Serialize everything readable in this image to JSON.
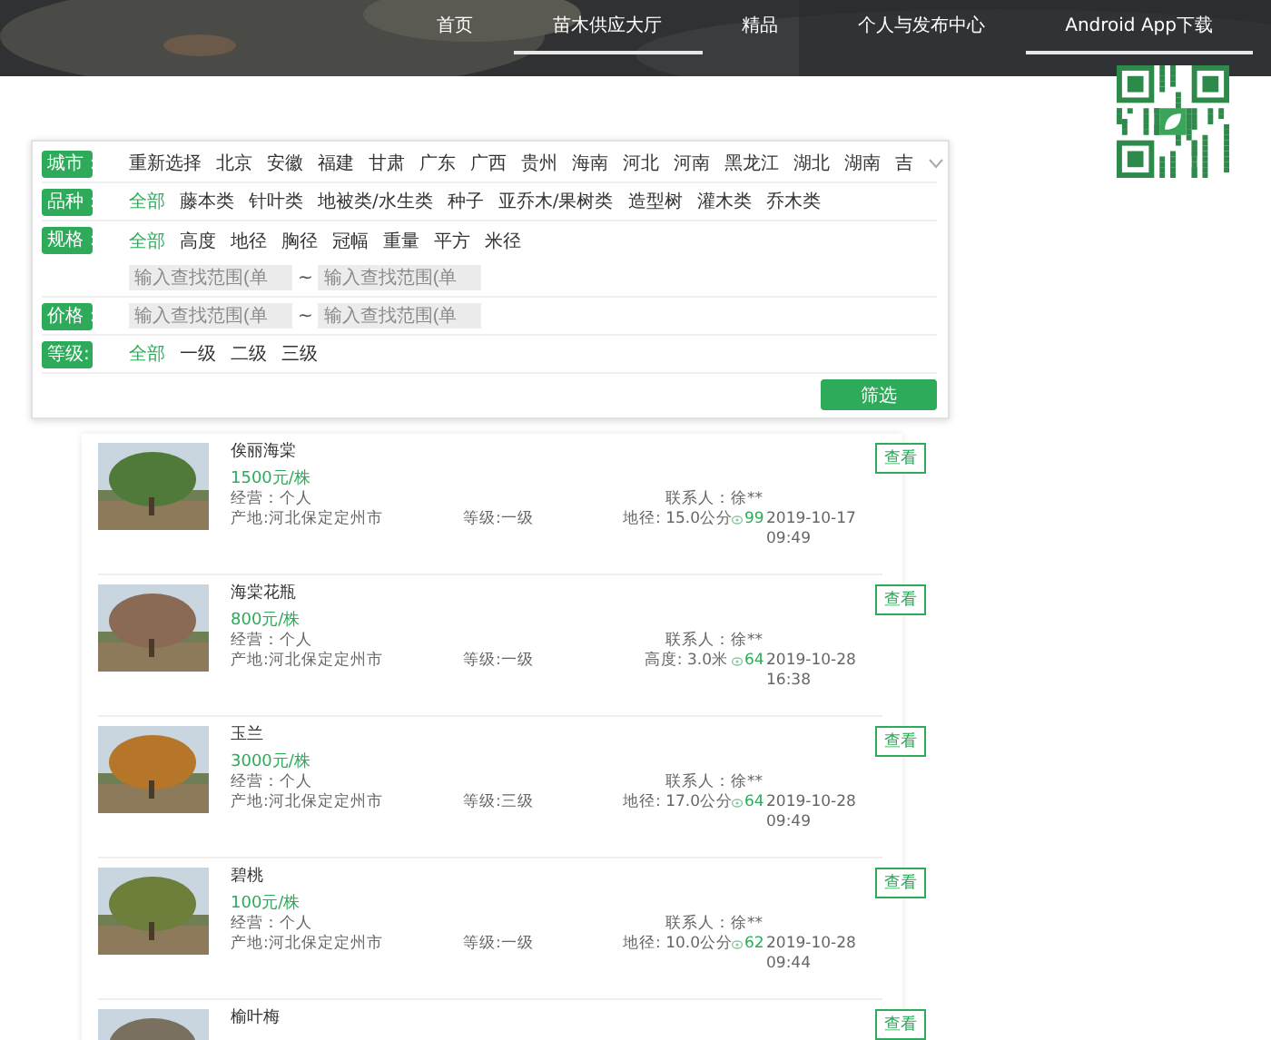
{
  "nav": [
    {
      "label": "首页",
      "selected": false
    },
    {
      "label": "苗木供应大厅",
      "selected": true
    },
    {
      "label": "精品",
      "selected": false
    },
    {
      "label": "个人与发布中心",
      "selected": false
    },
    {
      "label": "Android App下载",
      "selected": true
    }
  ],
  "filters": [
    {
      "label": "城市：",
      "expandable": true,
      "options": [
        {
          "label": "重新选择",
          "selected": false
        },
        {
          "label": "北京",
          "selected": false
        },
        {
          "label": "安徽",
          "selected": false
        },
        {
          "label": "福建",
          "selected": false
        },
        {
          "label": "甘肃",
          "selected": false
        },
        {
          "label": "广东",
          "selected": false
        },
        {
          "label": "广西",
          "selected": false
        },
        {
          "label": "贵州",
          "selected": false
        },
        {
          "label": "海南",
          "selected": false
        },
        {
          "label": "河北",
          "selected": false
        },
        {
          "label": "河南",
          "selected": false
        },
        {
          "label": "黑龙江",
          "selected": false
        },
        {
          "label": "湖北",
          "selected": false
        },
        {
          "label": "湖南",
          "selected": false
        },
        {
          "label": "吉",
          "selected": false
        }
      ]
    },
    {
      "label": "品种：",
      "options": [
        {
          "label": "全部",
          "selected": true
        },
        {
          "label": "藤本类",
          "selected": false
        },
        {
          "label": "针叶类",
          "selected": false
        },
        {
          "label": "地被类/水生类",
          "selected": false
        },
        {
          "label": "种子",
          "selected": false
        },
        {
          "label": "亚乔木/果树类",
          "selected": false
        },
        {
          "label": "造型树",
          "selected": false
        },
        {
          "label": "灌木类",
          "selected": false
        },
        {
          "label": "乔木类",
          "selected": false
        }
      ]
    },
    {
      "label": "规格：",
      "options": [
        {
          "label": "全部",
          "selected": true
        },
        {
          "label": "高度",
          "selected": false
        },
        {
          "label": "地径",
          "selected": false
        },
        {
          "label": "胸径",
          "selected": false
        },
        {
          "label": "冠幅",
          "selected": false
        },
        {
          "label": "重量",
          "selected": false
        },
        {
          "label": "平方",
          "selected": false
        },
        {
          "label": "米径",
          "selected": false
        }
      ],
      "range": {
        "from": {
          "placeholder": "输入查找范围(单"
        },
        "separator": "~",
        "to": {
          "placeholder": "输入查找范围(单"
        }
      }
    },
    {
      "label": "价格：",
      "range": {
        "from": {
          "placeholder": "输入查找范围(单"
        },
        "separator": "~",
        "to": {
          "placeholder": "输入查找范围(单"
        }
      }
    },
    {
      "label": "等级:",
      "options": [
        {
          "label": "全部",
          "selected": true
        },
        {
          "label": "一级",
          "selected": false
        },
        {
          "label": "二级",
          "selected": false
        },
        {
          "label": "三级",
          "selected": false
        }
      ]
    }
  ],
  "filter_button": "筛选",
  "listings": [
    {
      "title": "俟丽海棠",
      "price": "1500元/株",
      "business": "经营：个人",
      "contact": "联系人：徐**",
      "origin": "产地:河北保定定州市",
      "grade": "等级:一级",
      "spec": "地径: 15.0公分",
      "views": "99",
      "date": "2019-10-17",
      "time": "09:49",
      "button": "查看"
    },
    {
      "title": "海棠花瓶",
      "price": "800元/株",
      "business": "经营：个人",
      "contact": "联系人：徐**",
      "origin": "产地:河北保定定州市",
      "grade": "等级:一级",
      "spec": "高度: 3.0米",
      "views": "64",
      "date": "2019-10-28",
      "time": "16:38",
      "button": "查看"
    },
    {
      "title": "玉兰",
      "price": "3000元/株",
      "business": "经营：个人",
      "contact": "联系人：徐**",
      "origin": "产地:河北保定定州市",
      "grade": "等级:三级",
      "spec": "地径: 17.0公分",
      "views": "64",
      "date": "2019-10-28",
      "time": "09:49",
      "button": "查看"
    },
    {
      "title": "碧桃",
      "price": "100元/株",
      "business": "经营：个人",
      "contact": "联系人：徐**",
      "origin": "产地:河北保定定州市",
      "grade": "等级:一级",
      "spec": "地径: 10.0公分",
      "views": "62",
      "date": "2019-10-28",
      "time": "09:44",
      "button": "查看"
    },
    {
      "title": "榆叶梅",
      "button": "查看"
    }
  ]
}
